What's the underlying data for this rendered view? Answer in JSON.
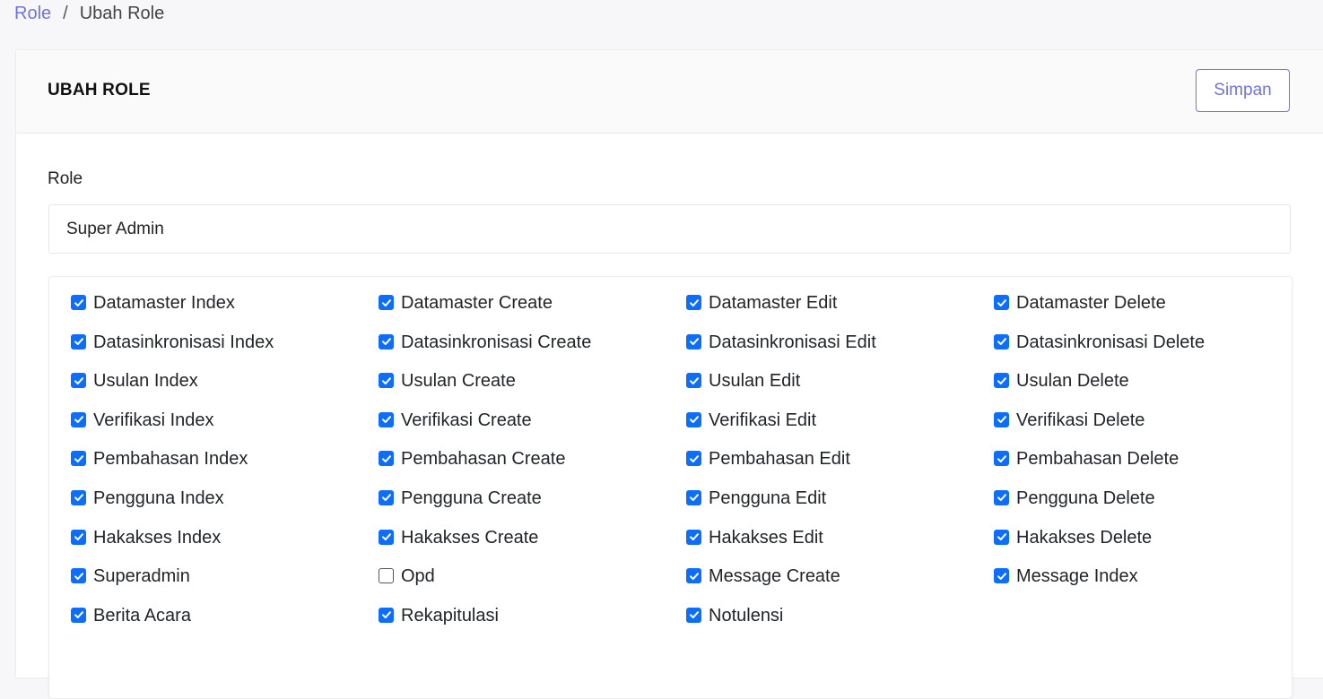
{
  "breadcrumb": {
    "link": "Role",
    "separator": "/",
    "current": "Ubah Role"
  },
  "card": {
    "title": "UBAH ROLE",
    "save_label": "Simpan"
  },
  "form": {
    "role_label": "Role",
    "role_value": "Super Admin"
  },
  "permissions": [
    {
      "label": "Datamaster Index",
      "checked": true
    },
    {
      "label": "Datamaster Create",
      "checked": true
    },
    {
      "label": "Datamaster Edit",
      "checked": true
    },
    {
      "label": "Datamaster Delete",
      "checked": true
    },
    {
      "label": "Datasinkronisasi Index",
      "checked": true
    },
    {
      "label": "Datasinkronisasi Create",
      "checked": true
    },
    {
      "label": "Datasinkronisasi Edit",
      "checked": true
    },
    {
      "label": "Datasinkronisasi Delete",
      "checked": true
    },
    {
      "label": "Usulan Index",
      "checked": true
    },
    {
      "label": "Usulan Create",
      "checked": true
    },
    {
      "label": "Usulan Edit",
      "checked": true
    },
    {
      "label": "Usulan Delete",
      "checked": true
    },
    {
      "label": "Verifikasi Index",
      "checked": true
    },
    {
      "label": "Verifikasi Create",
      "checked": true
    },
    {
      "label": "Verifikasi Edit",
      "checked": true
    },
    {
      "label": "Verifikasi Delete",
      "checked": true
    },
    {
      "label": "Pembahasan Index",
      "checked": true
    },
    {
      "label": "Pembahasan Create",
      "checked": true
    },
    {
      "label": "Pembahasan Edit",
      "checked": true
    },
    {
      "label": "Pembahasan Delete",
      "checked": true
    },
    {
      "label": "Pengguna Index",
      "checked": true
    },
    {
      "label": "Pengguna Create",
      "checked": true
    },
    {
      "label": "Pengguna Edit",
      "checked": true
    },
    {
      "label": "Pengguna Delete",
      "checked": true
    },
    {
      "label": "Hakakses Index",
      "checked": true
    },
    {
      "label": "Hakakses Create",
      "checked": true
    },
    {
      "label": "Hakakses Edit",
      "checked": true
    },
    {
      "label": "Hakakses Delete",
      "checked": true
    },
    {
      "label": "Superadmin",
      "checked": true
    },
    {
      "label": "Opd",
      "checked": false
    },
    {
      "label": "Message Create",
      "checked": true
    },
    {
      "label": "Message Index",
      "checked": true
    },
    {
      "label": "Berita Acara",
      "checked": true
    },
    {
      "label": "Rekapitulasi",
      "checked": true
    },
    {
      "label": "Notulensi",
      "checked": true
    }
  ],
  "colors": {
    "accent": "#6f74e0",
    "checkbox": "#0d6efd"
  }
}
